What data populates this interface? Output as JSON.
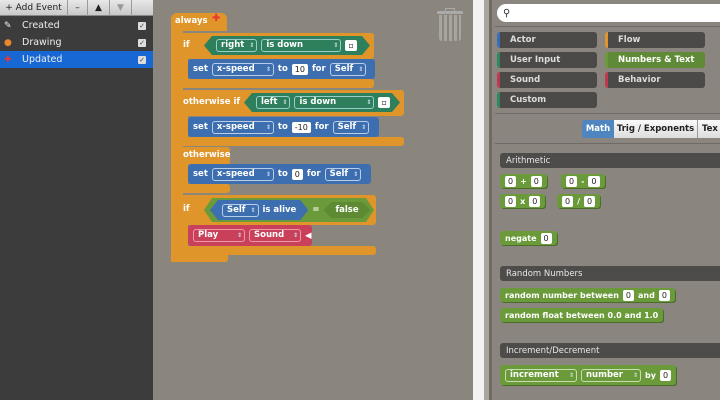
{
  "toolbar": {
    "add_event": "+ Add Event",
    "remove": "–",
    "up": "▲",
    "down": "▼"
  },
  "events": [
    {
      "label": "Created",
      "icon": "wand-icon",
      "checked": true
    },
    {
      "label": "Drawing",
      "icon": "palette-icon",
      "checked": true
    },
    {
      "label": "Updated",
      "icon": "pin-icon",
      "checked": true,
      "selected": true
    }
  ],
  "script": {
    "always": "always",
    "if1": {
      "kw": "if",
      "key": "right",
      "cond": "is down",
      "set": "set",
      "prop": "x-speed",
      "to": "to",
      "val": "10",
      "for": "for",
      "target": "Self"
    },
    "elseif": {
      "kw": "otherwise if",
      "key": "left",
      "cond": "is down",
      "set": "set",
      "prop": "x-speed",
      "to": "to",
      "val": "-10",
      "for": "for",
      "target": "Self"
    },
    "else": {
      "kw": "otherwise",
      "set": "set",
      "prop": "x-speed",
      "to": "to",
      "val": "0",
      "for": "for",
      "target": "Self"
    },
    "if2": {
      "kw": "if",
      "actor": "Self",
      "is_alive": "is alive",
      "eq": "=",
      "value": "false",
      "play": "Play",
      "sound": "Sound"
    }
  },
  "palette": {
    "search_placeholder": "",
    "categories": [
      {
        "label": "Actor",
        "color": "#3a6fb5"
      },
      {
        "label": "Flow",
        "color": "#e0952b"
      },
      {
        "label": "User Input",
        "color": "#2e8a5e"
      },
      {
        "label": "Numbers & Text",
        "color": "#6b9a3a",
        "selected": true
      },
      {
        "label": "Sound",
        "color": "#c0394f"
      },
      {
        "label": "Behavior",
        "color": "#c0394f"
      },
      {
        "label": "Custom",
        "color": "#2e8a5e"
      }
    ],
    "tabs": [
      {
        "label": "Math",
        "active": true
      },
      {
        "label": "Trig / Exponents"
      },
      {
        "label": "Tex"
      }
    ],
    "sections": {
      "arith": "Arithmetic",
      "random": "Random Numbers",
      "incdec": "Increment/Decrement"
    },
    "blocks": {
      "zero": "0",
      "plus": "+",
      "minus": "-",
      "times": "x",
      "div": "/",
      "negate": "negate",
      "rnb": "random number between",
      "and": "and",
      "rfloat": "random float between 0.0 and 1.0",
      "increment": "increment",
      "number": "number",
      "by": "by"
    }
  }
}
